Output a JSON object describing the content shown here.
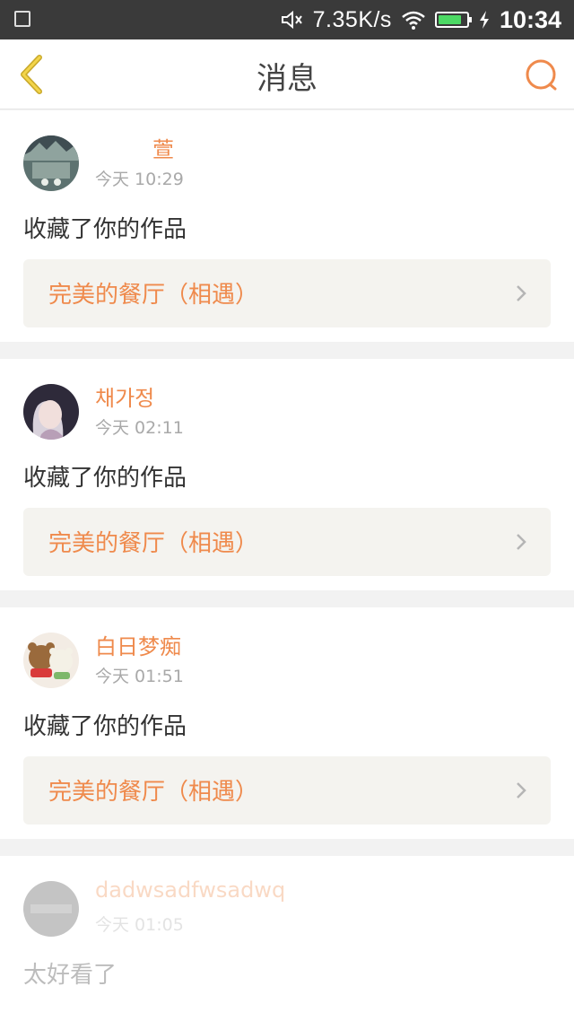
{
  "status_bar": {
    "speed": "7.35K/s",
    "time": "10:34",
    "battery_level": 0.85,
    "battery_color": "#4cd964"
  },
  "nav": {
    "title": "消息",
    "back_icon": "chevron-left-icon",
    "search_icon": "search-icon",
    "accent_color": "#ef8a4c"
  },
  "messages": [
    {
      "user": "萱",
      "time": "今天  10:29",
      "action": "收藏了你的作品",
      "work": "完美的餐厅（相遇）"
    },
    {
      "user": "채가정",
      "time": "今天  02:11",
      "action": "收藏了你的作品",
      "work": "完美的餐厅（相遇）"
    },
    {
      "user": "白日梦痴",
      "time": "今天  01:51",
      "action": "收藏了你的作品",
      "work": "完美的餐厅（相遇）"
    },
    {
      "user": "dadwsadfwsadwq",
      "time": "今天  01:05",
      "action": "太好看了"
    }
  ]
}
